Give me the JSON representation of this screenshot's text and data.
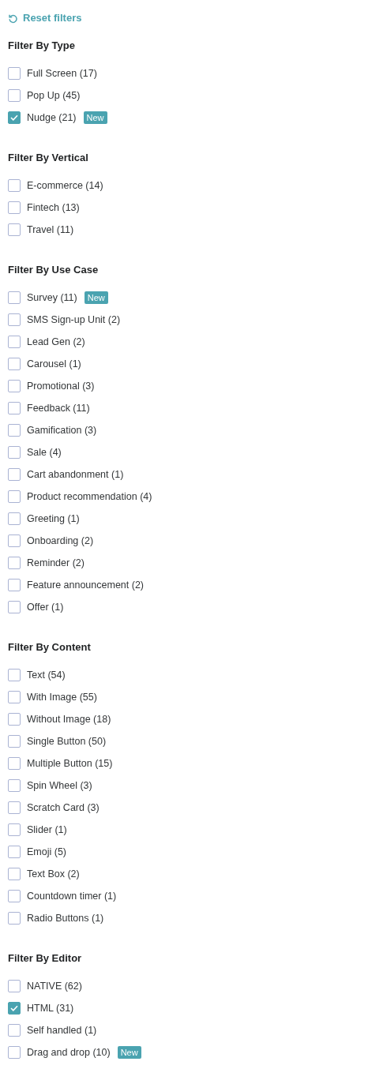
{
  "reset": {
    "label": "Reset filters"
  },
  "sections": [
    {
      "title": "Filter By Type",
      "options": [
        {
          "label": "Full Screen (17)",
          "checked": false
        },
        {
          "label": "Pop Up (45)",
          "checked": false
        },
        {
          "label": "Nudge (21)",
          "checked": true,
          "badge": "New"
        }
      ]
    },
    {
      "title": "Filter By Vertical",
      "options": [
        {
          "label": "E-commerce (14)",
          "checked": false
        },
        {
          "label": "Fintech (13)",
          "checked": false
        },
        {
          "label": "Travel (11)",
          "checked": false
        }
      ]
    },
    {
      "title": "Filter By Use Case",
      "options": [
        {
          "label": "Survey (11)",
          "checked": false,
          "badge": "New"
        },
        {
          "label": "SMS Sign-up Unit (2)",
          "checked": false
        },
        {
          "label": "Lead Gen (2)",
          "checked": false
        },
        {
          "label": "Carousel (1)",
          "checked": false
        },
        {
          "label": "Promotional (3)",
          "checked": false
        },
        {
          "label": "Feedback (11)",
          "checked": false
        },
        {
          "label": "Gamification (3)",
          "checked": false
        },
        {
          "label": "Sale (4)",
          "checked": false
        },
        {
          "label": "Cart abandonment (1)",
          "checked": false
        },
        {
          "label": "Product recommendation (4)",
          "checked": false
        },
        {
          "label": "Greeting (1)",
          "checked": false
        },
        {
          "label": "Onboarding (2)",
          "checked": false
        },
        {
          "label": "Reminder (2)",
          "checked": false
        },
        {
          "label": "Feature announcement (2)",
          "checked": false
        },
        {
          "label": "Offer (1)",
          "checked": false
        }
      ]
    },
    {
      "title": "Filter By Content",
      "options": [
        {
          "label": "Text (54)",
          "checked": false
        },
        {
          "label": "With Image (55)",
          "checked": false
        },
        {
          "label": "Without Image (18)",
          "checked": false
        },
        {
          "label": "Single Button (50)",
          "checked": false
        },
        {
          "label": "Multiple Button (15)",
          "checked": false
        },
        {
          "label": "Spin Wheel (3)",
          "checked": false
        },
        {
          "label": "Scratch Card (3)",
          "checked": false
        },
        {
          "label": "Slider (1)",
          "checked": false
        },
        {
          "label": "Emoji (5)",
          "checked": false
        },
        {
          "label": "Text Box (2)",
          "checked": false
        },
        {
          "label": "Countdown timer (1)",
          "checked": false
        },
        {
          "label": "Radio Buttons (1)",
          "checked": false
        }
      ]
    },
    {
      "title": "Filter By Editor",
      "options": [
        {
          "label": "NATIVE (62)",
          "checked": false
        },
        {
          "label": "HTML (31)",
          "checked": true
        },
        {
          "label": "Self handled (1)",
          "checked": false
        },
        {
          "label": "Drag and drop (10)",
          "checked": false,
          "badge": "New"
        }
      ]
    }
  ]
}
